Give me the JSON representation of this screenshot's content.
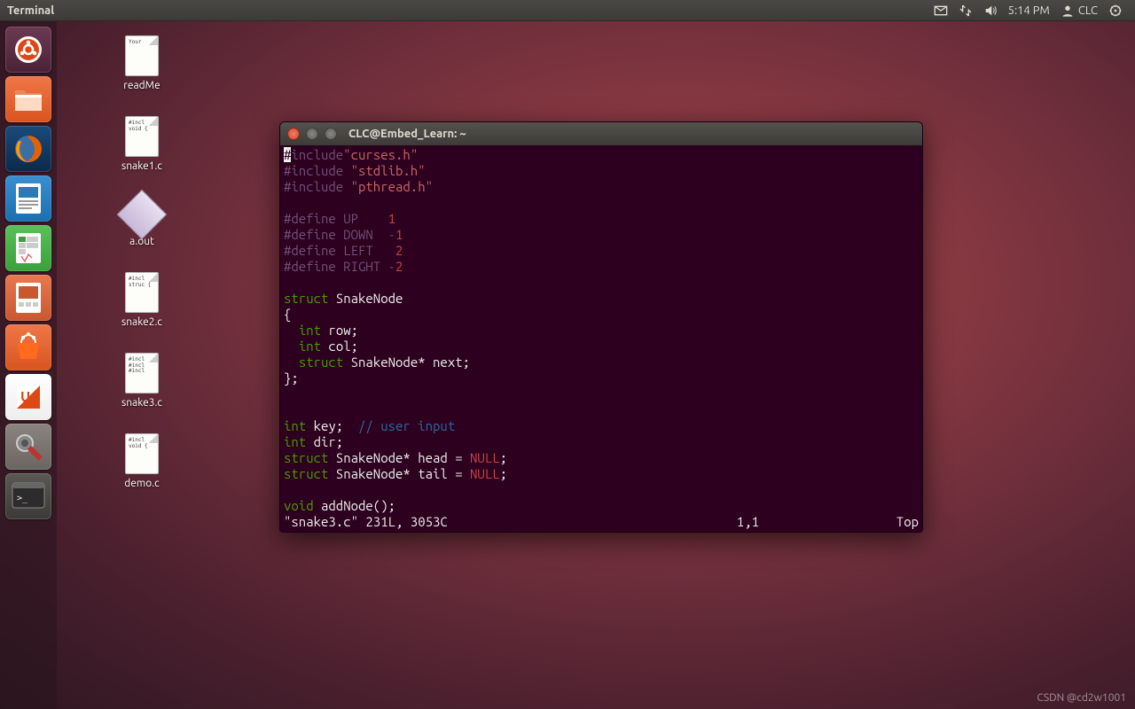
{
  "topbar": {
    "app_label": "Terminal",
    "time": "5:14 PM",
    "user": "CLC"
  },
  "launcher": {
    "items": [
      {
        "name": "dash",
        "color": "#5b2942"
      },
      {
        "name": "files",
        "color": "#e95420"
      },
      {
        "name": "firefox",
        "color": "#0b2a4a"
      },
      {
        "name": "writer",
        "color": "#1a6fb0"
      },
      {
        "name": "calc",
        "color": "#3aa03a"
      },
      {
        "name": "impress",
        "color": "#c9572f"
      },
      {
        "name": "software",
        "color": "#d85c2a"
      },
      {
        "name": "ubuntuone",
        "color": "#ffffff"
      },
      {
        "name": "settings",
        "color": "#6a6560"
      },
      {
        "name": "terminal",
        "color": "#3b3a36"
      }
    ]
  },
  "desktop": {
    "icons": [
      {
        "label": "readMe",
        "type": "file",
        "preview": "Your"
      },
      {
        "label": "snake1.c",
        "type": "file",
        "preview": "#incl\nvoid\n{"
      },
      {
        "label": "a.out",
        "type": "exec",
        "preview": ""
      },
      {
        "label": "snake2.c",
        "type": "file",
        "preview": "#incl\nstruc\n{"
      },
      {
        "label": "snake3.c",
        "type": "file",
        "preview": "#incl\n#incl\n#incl"
      },
      {
        "label": "demo.c",
        "type": "file",
        "preview": "#incl\nvoid\n{"
      }
    ]
  },
  "terminal": {
    "title": "CLC@Embed_Learn: ~",
    "code": {
      "l1_inc": "#include",
      "l1_str": "\"curses.h\"",
      "l2_inc": "#include ",
      "l2_str": "\"stdlib.h\"",
      "l3_inc": "#include ",
      "l3_str": "\"pthread.h\"",
      "d1": "#define UP    ",
      "d1v": "1",
      "d2": "#define DOWN  -",
      "d2v": "1",
      "d3": "#define LEFT   ",
      "d3v": "2",
      "d4": "#define RIGHT -",
      "d4v": "2",
      "struct_kw": "struct",
      "struct_name": " SnakeNode",
      "brace_o": "{",
      "int_kw": "int",
      "row": " row;",
      "col": " col;",
      "struct_kw2": "struct",
      "next": " SnakeNode* next;",
      "brace_c": "};",
      "key_decl": " key;  ",
      "key_cmt": "// user input",
      "dir_decl": " dir;",
      "head_decl": " SnakeNode* head = ",
      "null1": "NULL",
      "semi": ";",
      "tail_decl": " SnakeNode* tail = ",
      "null2": "NULL",
      "void_kw": "void",
      "addnode": " addNode();"
    },
    "status": {
      "left": "\"snake3.c\" 231L, 3053C",
      "pos": "1,1",
      "scroll": "Top"
    }
  },
  "watermark": "CSDN @cd2w1001"
}
